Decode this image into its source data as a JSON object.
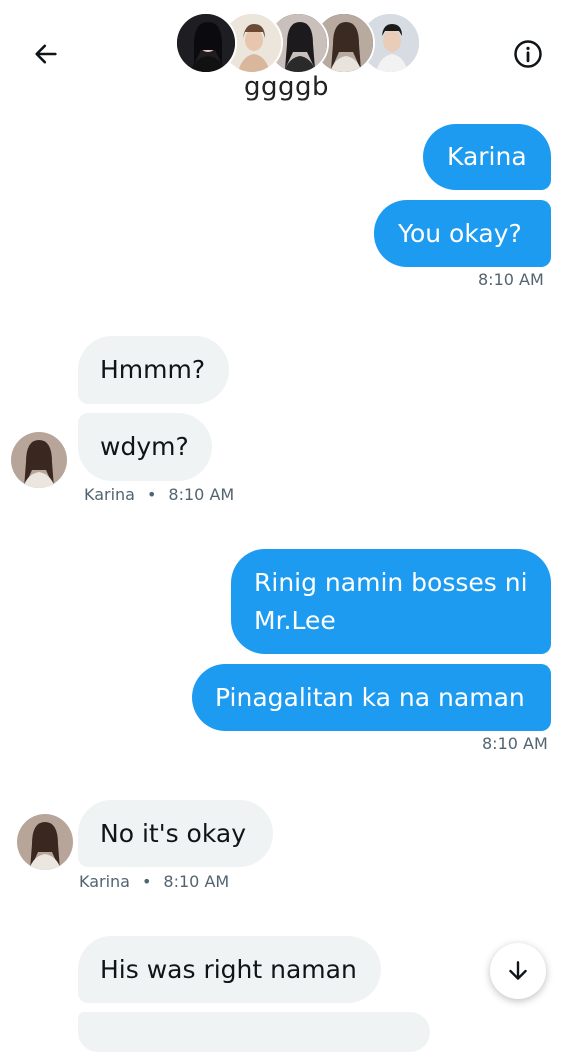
{
  "header": {
    "group_name": "ggggb",
    "back_icon": "arrow-left-icon",
    "info_icon": "info-circle-icon"
  },
  "messages": [
    {
      "text": "Karina",
      "direction": "outgoing"
    },
    {
      "text": "You okay?",
      "direction": "outgoing"
    },
    {
      "time": "8:10 AM"
    },
    {
      "text": "Hmmm?",
      "direction": "incoming"
    },
    {
      "text": "wdym?",
      "direction": "incoming"
    },
    {
      "sender": "Karina",
      "time": "8:10 AM"
    },
    {
      "text_line1": "Rinig namin bosses ni",
      "text_line2": "Mr.Lee",
      "direction": "outgoing"
    },
    {
      "text": "Pinagalitan ka na naman",
      "direction": "outgoing"
    },
    {
      "time": "8:10 AM"
    },
    {
      "text": "No it's okay",
      "direction": "incoming"
    },
    {
      "sender": "Karina",
      "time": "8:10 AM"
    },
    {
      "text": "His was right naman",
      "direction": "incoming"
    }
  ],
  "scroll_down_icon": "arrow-down-icon",
  "colors": {
    "outgoing_bubble": "#1d9bf0",
    "incoming_bubble": "#eff3f4",
    "meta_text": "#536471"
  }
}
